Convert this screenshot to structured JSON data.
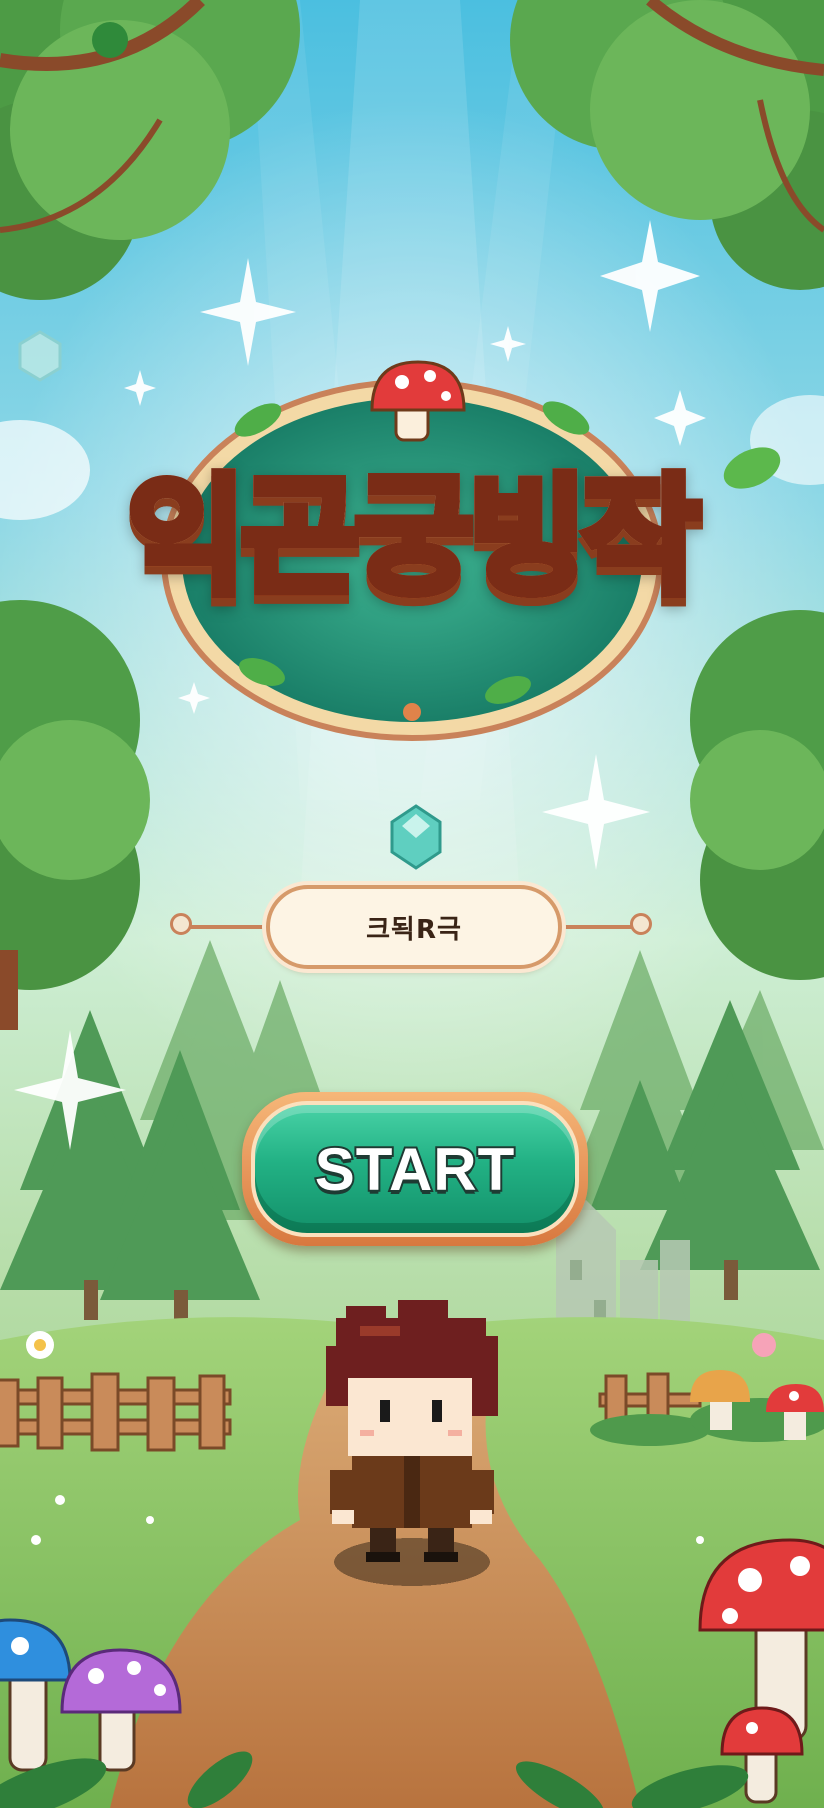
{
  "game": {
    "title": "익곤궁빙작",
    "subtitle": "크됙R극",
    "start_label": "START"
  },
  "icons": {
    "logo_topper": "red-mushroom-icon",
    "gem": "teal-gem-icon",
    "player": "pixel-hero-character"
  },
  "colors": {
    "sky_top": "#58c4e0",
    "forest_green": "#5aa85a",
    "start_button": "#22b184",
    "start_button_rim": "#e8894a",
    "title_outline": "#7a2c16",
    "banner_fill": "#fdf4e4",
    "path_dirt": "#c8874f"
  }
}
